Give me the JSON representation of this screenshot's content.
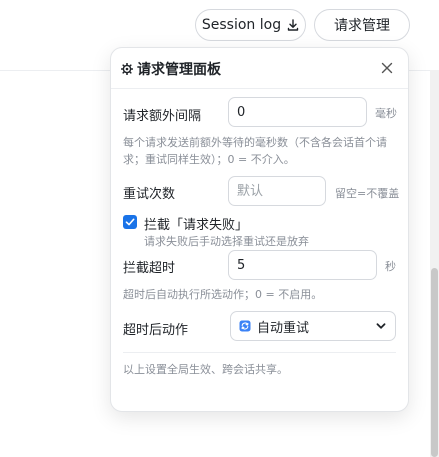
{
  "topbar": {
    "session_log_label": "Session log",
    "request_manage_label": "请求管理",
    "download_icon": "download-icon"
  },
  "panel": {
    "title": "请求管理面板",
    "title_icon": "gear-icon",
    "close_icon": "close-icon",
    "extra_interval": {
      "label": "请求额外间隔",
      "value": "0",
      "unit": "毫秒",
      "hint": "每个请求发送前额外等待的毫秒数（不含各会话首个请求；重试同样生效）；0 = 不介入。"
    },
    "retry_count": {
      "label": "重试次数",
      "value": "",
      "placeholder": "默认",
      "unit": "留空=不覆盖"
    },
    "intercept_failure": {
      "checked": true,
      "label": "拦截「请求失败」",
      "hint": "请求失败后手动选择重试还是放弃"
    },
    "intercept_timeout": {
      "label": "拦截超时",
      "value": "5",
      "unit": "秒",
      "hint": "超时后自动执行所选动作；0 = 不启用。"
    },
    "timeout_action": {
      "label": "超时后动作",
      "selected": "自动重试",
      "icon": "retry-icon"
    },
    "footer_note": "以上设置全局生效、跨会话共享。"
  },
  "colors": {
    "accent": "#1a73e8",
    "hint_text": "#8a8f98",
    "border": "#d6d9de"
  }
}
